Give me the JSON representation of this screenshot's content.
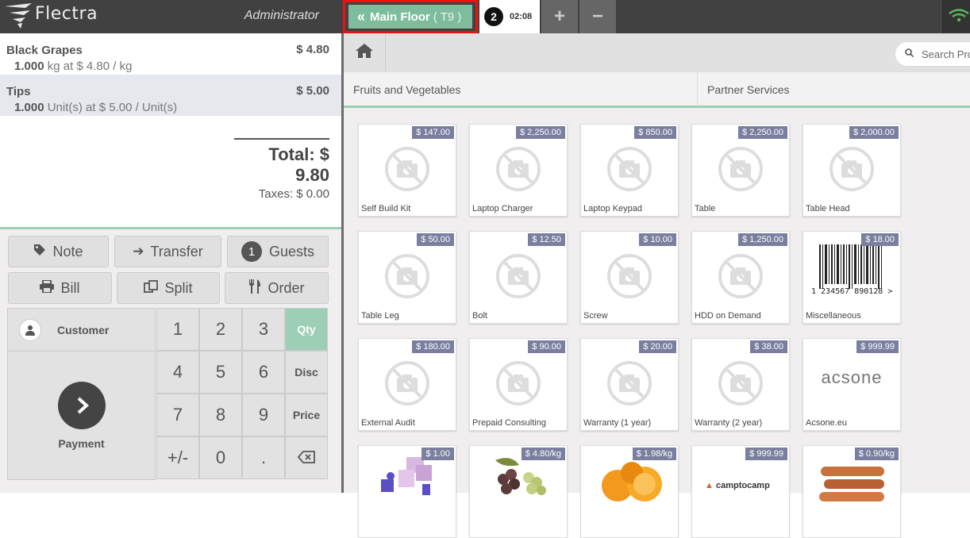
{
  "topbar": {
    "logo_text": "Flectra",
    "username": "Administrator",
    "floor_button": {
      "label": "Main Floor",
      "table": "( T9 )"
    },
    "order_tab": {
      "number": "2",
      "time": "02:08"
    },
    "add_order": "+",
    "remove_order": "−"
  },
  "orderlines": [
    {
      "name": "Black Grapes",
      "price": "$ 4.80",
      "qty": "1.000",
      "info": "kg at $ 4.80 / kg",
      "selected": false
    },
    {
      "name": "Tips",
      "price": "$ 5.00",
      "qty": "1.000",
      "info": "Unit(s) at $ 5.00 / Unit(s)",
      "selected": true
    }
  ],
  "summary": {
    "total": "Total: $ 9.80",
    "taxes": "Taxes: $ 0.00"
  },
  "control_buttons": {
    "note": "Note",
    "transfer": "Transfer",
    "guests_count": "1",
    "guests": "Guests",
    "bill": "Bill",
    "split": "Split",
    "order": "Order"
  },
  "numpad": {
    "customer": "Customer",
    "payment": "Payment",
    "keys": [
      "1",
      "2",
      "3",
      "4",
      "5",
      "6",
      "7",
      "8",
      "9",
      "+/-",
      "0",
      "."
    ],
    "modes": {
      "qty": "Qty",
      "disc": "Disc",
      "price": "Price"
    },
    "active_mode": "Qty"
  },
  "search": {
    "placeholder": "Search Products"
  },
  "categories": [
    "Fruits and Vegetables",
    "Partner Services"
  ],
  "products": [
    {
      "name": "Self Build Kit",
      "price": "$ 147.00",
      "image": "placeholder"
    },
    {
      "name": "Laptop Charger",
      "price": "$ 2,250.00",
      "image": "placeholder"
    },
    {
      "name": "Laptop Keypad",
      "price": "$ 850.00",
      "image": "placeholder"
    },
    {
      "name": "Table",
      "price": "$ 2,250.00",
      "image": "placeholder"
    },
    {
      "name": "Table Head",
      "price": "$ 2,000.00",
      "image": "placeholder"
    },
    {
      "name": "Table Leg",
      "price": "$ 50.00",
      "image": "placeholder"
    },
    {
      "name": "Bolt",
      "price": "$ 12.50",
      "image": "placeholder"
    },
    {
      "name": "Screw",
      "price": "$ 10.00",
      "image": "placeholder"
    },
    {
      "name": "HDD on Demand",
      "price": "$ 1,250.00",
      "image": "placeholder"
    },
    {
      "name": "Miscellaneous",
      "price": "$ 18.00",
      "image": "barcode",
      "barcode_text": "1 234567 890128 >"
    },
    {
      "name": "External Audit",
      "price": "$ 180.00",
      "image": "placeholder"
    },
    {
      "name": "Prepaid Consulting",
      "price": "$ 90.00",
      "image": "placeholder"
    },
    {
      "name": "Warranty (1 year)",
      "price": "$ 20.00",
      "image": "placeholder"
    },
    {
      "name": "Warranty (2 year)",
      "price": "$ 38.00",
      "image": "placeholder"
    },
    {
      "name": "Acsone.eu",
      "price": "$ 999.99",
      "image": "logo",
      "logo_text": "acsone"
    },
    {
      "name": "",
      "price": "$ 1.00",
      "image": "puzzle"
    },
    {
      "name": "",
      "price": "$ 4.80/kg",
      "image": "grapes"
    },
    {
      "name": "",
      "price": "$ 1.98/kg",
      "image": "oranges"
    },
    {
      "name": "",
      "price": "$ 999.99",
      "image": "logo",
      "logo_text": "camptocamp"
    },
    {
      "name": "",
      "price": "$ 0.90/kg",
      "image": "carrots"
    }
  ],
  "colors": {
    "accent": "#9ccfb5",
    "topbar": "#414141",
    "price_badge": "#7a7f9f",
    "highlight": "#e11111"
  }
}
